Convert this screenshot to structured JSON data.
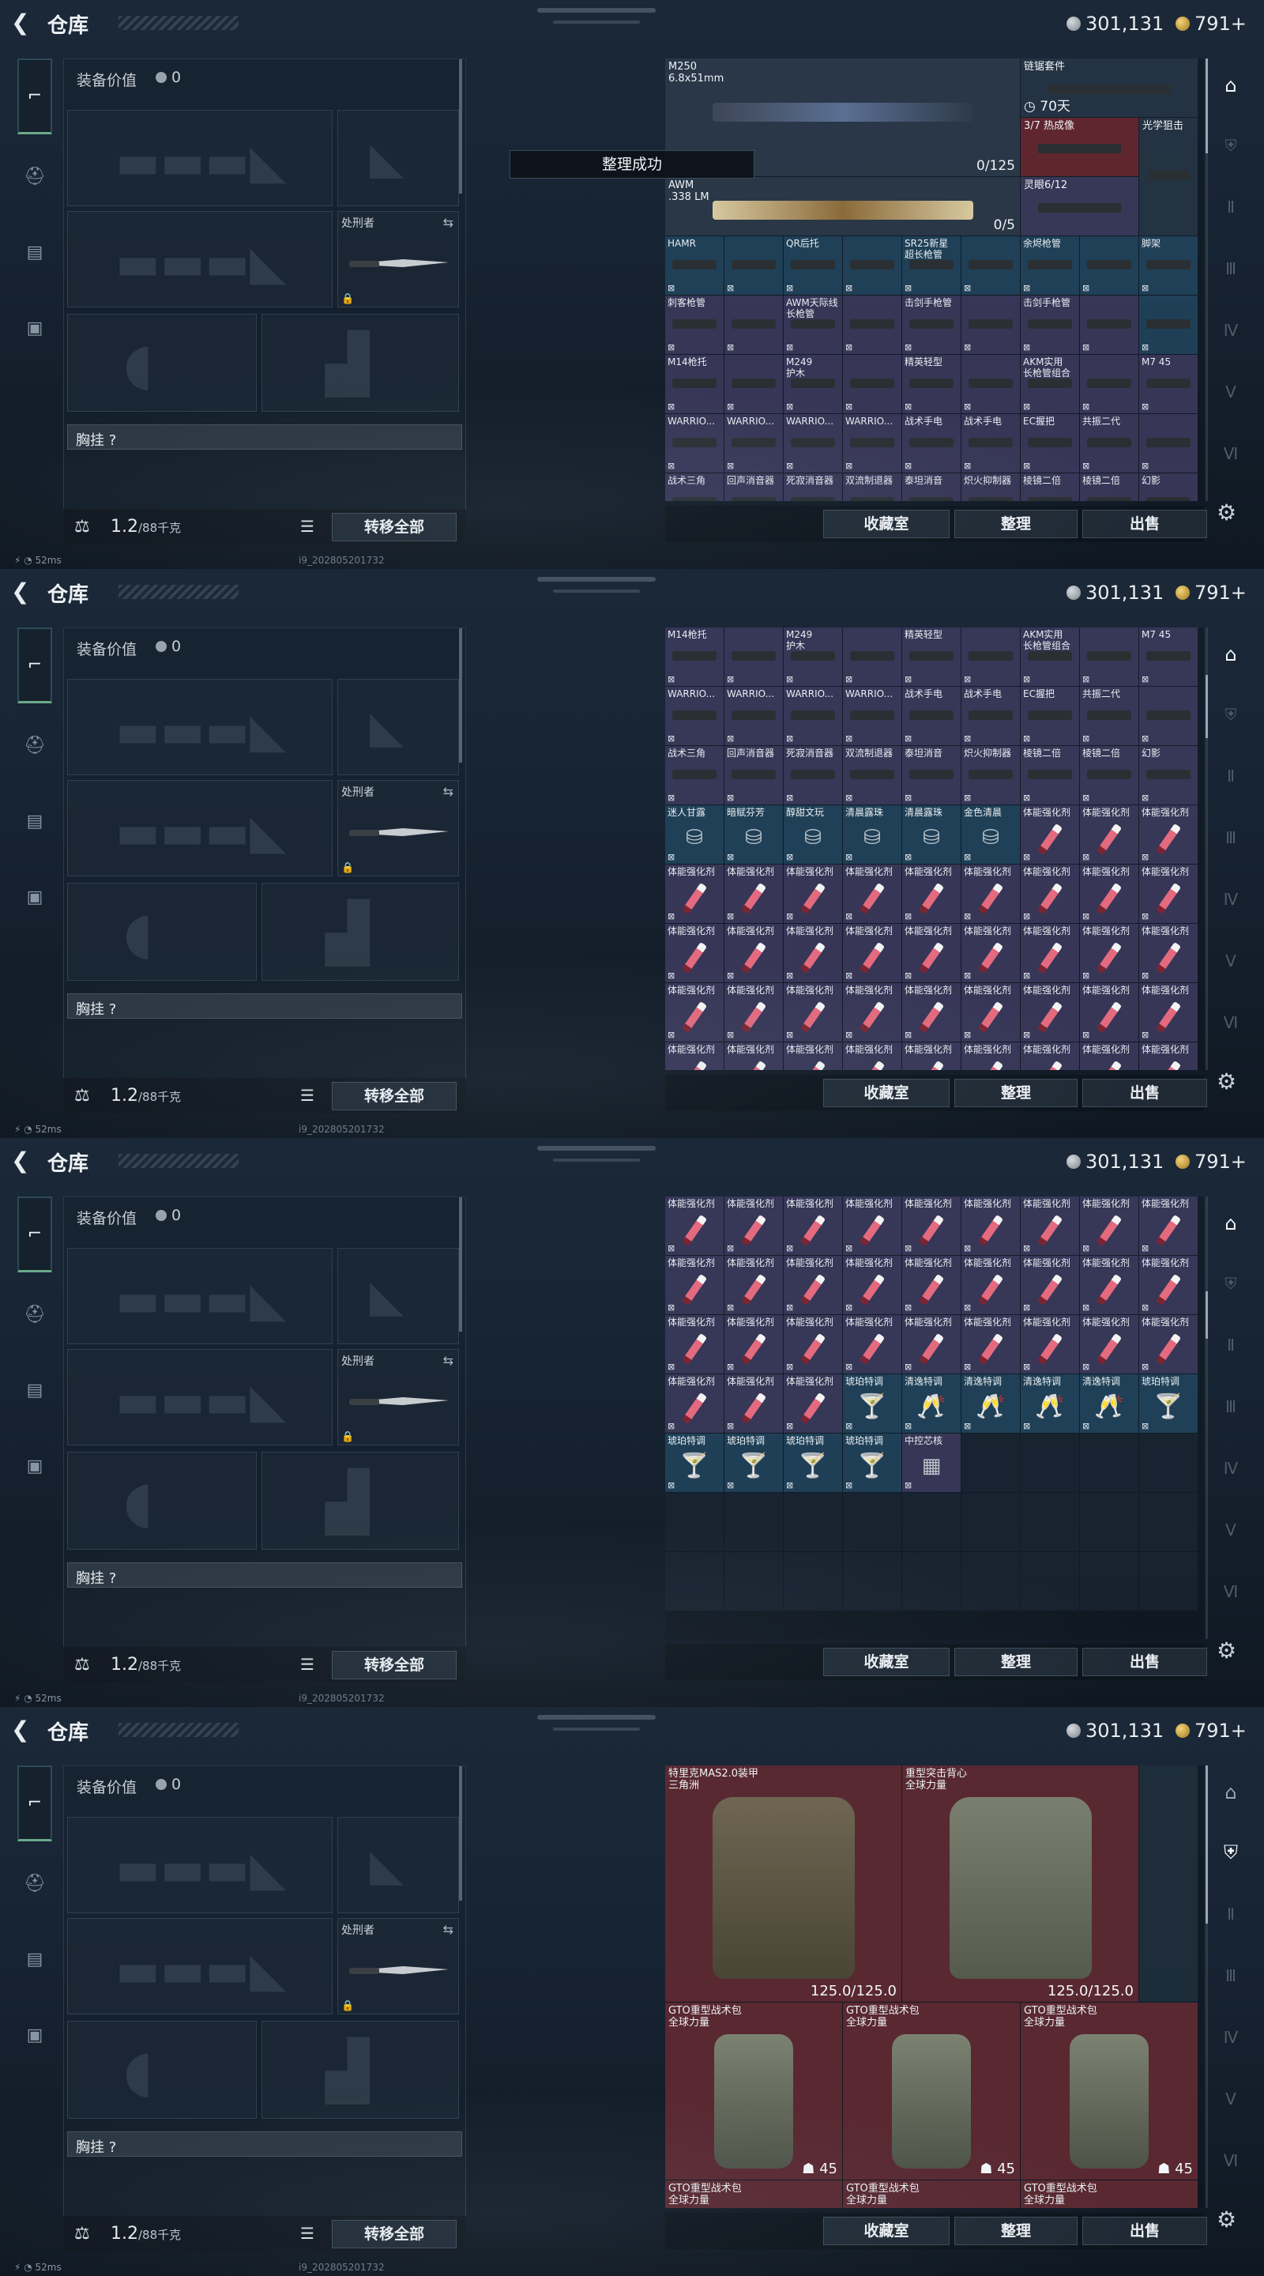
{
  "header": {
    "title": "仓库",
    "back_icon": "back-arrow-icon",
    "currency_silver": "301,131",
    "currency_gold": "791+"
  },
  "left": {
    "equip_value_label": "装备价值",
    "equip_value": "0",
    "knife_label": "处刑者",
    "vest_label": "胸挂 ?",
    "weight": "1.2",
    "weight_unit": "/88千克",
    "move_all": "转移全部"
  },
  "status": {
    "ping": "52ms",
    "build": "i9_20280520173​2"
  },
  "toast": "整理成功",
  "buttons": {
    "store": "收藏室",
    "sort": "整理",
    "sell": "出售"
  },
  "frame0": {
    "big": [
      {
        "name": "M250\n6.8x51mm",
        "count": "0/125"
      },
      {
        "name": "AWM\n.338 LM",
        "count": "0/5"
      }
    ],
    "side": [
      {
        "name": "链锯套件",
        "count": "70天"
      },
      {
        "name": "3/7 热成像"
      },
      {
        "name": "光学狙击"
      },
      {
        "name": "灵眼6/12"
      }
    ],
    "cells": [
      {
        "n": "HAMR",
        "c": "blue"
      },
      {
        "n": "",
        "c": "blue"
      },
      {
        "n": "QR后托",
        "c": "blue"
      },
      {
        "n": "",
        "c": "blue"
      },
      {
        "n": "SR25新星\n超长枪管",
        "c": "blue"
      },
      {
        "n": "",
        "c": "blue"
      },
      {
        "n": "余烬枪管",
        "c": "blue"
      },
      {
        "n": "",
        "c": "blue"
      },
      {
        "n": "脚架",
        "c": "blue"
      },
      {
        "n": "刺客枪管",
        "c": "purple"
      },
      {
        "n": "",
        "c": "purple"
      },
      {
        "n": "AWM天际线\n长枪管",
        "c": "purple"
      },
      {
        "n": "",
        "c": "purple"
      },
      {
        "n": "击剑手枪管",
        "c": "purple"
      },
      {
        "n": "",
        "c": "purple"
      },
      {
        "n": "击剑手枪管",
        "c": "purple"
      },
      {
        "n": "",
        "c": "purple"
      },
      {
        "n": "",
        "c": "blue"
      },
      {
        "n": "M14枪托",
        "c": "purple"
      },
      {
        "n": "",
        "c": "purple"
      },
      {
        "n": "M249\n护木",
        "c": "purple"
      },
      {
        "n": "",
        "c": "purple"
      },
      {
        "n": "精英轻型",
        "c": "purple"
      },
      {
        "n": "",
        "c": "purple"
      },
      {
        "n": "AKM实用\n长枪管组合",
        "c": "purple"
      },
      {
        "n": "",
        "c": "purple"
      },
      {
        "n": "M7 45",
        "c": "purple"
      },
      {
        "n": "WARRIO...",
        "c": "purple"
      },
      {
        "n": "WARRIO...",
        "c": "purple"
      },
      {
        "n": "WARRIO...",
        "c": "purple"
      },
      {
        "n": "WARRIO...",
        "c": "purple"
      },
      {
        "n": "战术手电",
        "c": "purple"
      },
      {
        "n": "战术手电",
        "c": "purple"
      },
      {
        "n": "EC握把",
        "c": "purple"
      },
      {
        "n": "共振二代",
        "c": "purple"
      },
      {
        "n": "",
        "c": "purple"
      },
      {
        "n": "战术三角",
        "c": "purple"
      },
      {
        "n": "回声消音器",
        "c": "purple"
      },
      {
        "n": "死寂消音器",
        "c": "purple"
      },
      {
        "n": "双流制退器",
        "c": "purple"
      },
      {
        "n": "泰坦消音",
        "c": "purple"
      },
      {
        "n": "炽火抑制器",
        "c": "purple"
      },
      {
        "n": "棱镜二倍",
        "c": "purple"
      },
      {
        "n": "棱镜二倍",
        "c": "purple"
      },
      {
        "n": "幻影",
        "c": "purple"
      }
    ]
  },
  "frame1": {
    "cells": [
      {
        "n": "M14枪托",
        "c": "purple"
      },
      {
        "n": "",
        "c": "purple"
      },
      {
        "n": "M249\n护木",
        "c": "purple"
      },
      {
        "n": "",
        "c": "purple"
      },
      {
        "n": "精英轻型",
        "c": "purple"
      },
      {
        "n": "",
        "c": "purple"
      },
      {
        "n": "AKM实用\n长枪管组合",
        "c": "purple"
      },
      {
        "n": "",
        "c": "purple"
      },
      {
        "n": "M7 45",
        "c": "purple"
      },
      {
        "n": "WARRIO...",
        "c": "purple"
      },
      {
        "n": "WARRIO...",
        "c": "purple"
      },
      {
        "n": "WARRIO...",
        "c": "purple"
      },
      {
        "n": "WARRIO...",
        "c": "purple"
      },
      {
        "n": "战术手电",
        "c": "purple"
      },
      {
        "n": "战术手电",
        "c": "purple"
      },
      {
        "n": "EC握把",
        "c": "purple"
      },
      {
        "n": "共振二代",
        "c": "purple"
      },
      {
        "n": "",
        "c": "purple"
      },
      {
        "n": "战术三角",
        "c": "purple"
      },
      {
        "n": "回声消音器",
        "c": "purple"
      },
      {
        "n": "死寂消音器",
        "c": "purple"
      },
      {
        "n": "双流制退器",
        "c": "purple"
      },
      {
        "n": "泰坦消音",
        "c": "purple"
      },
      {
        "n": "炽火抑制器",
        "c": "purple"
      },
      {
        "n": "棱镜二倍",
        "c": "purple"
      },
      {
        "n": "棱镜二倍",
        "c": "purple"
      },
      {
        "n": "幻影",
        "c": "purple"
      },
      {
        "n": "迷人甘露",
        "c": "blue",
        "g": "jar"
      },
      {
        "n": "暗赋芬芳",
        "c": "blue",
        "g": "jar"
      },
      {
        "n": "醇甜文玩",
        "c": "blue",
        "g": "jar"
      },
      {
        "n": "清晨露珠",
        "c": "blue",
        "g": "jar"
      },
      {
        "n": "清晨露珠",
        "c": "blue",
        "g": "jar"
      },
      {
        "n": "金色清晨",
        "c": "blue",
        "g": "jar"
      },
      {
        "n": "体能强化剂",
        "c": "purple",
        "g": "vial"
      },
      {
        "n": "体能强化剂",
        "c": "purple",
        "g": "vial"
      },
      {
        "n": "体能强化剂",
        "c": "purple",
        "g": "vial"
      },
      {
        "n": "体能强化剂",
        "c": "purple",
        "g": "vial"
      },
      {
        "n": "体能强化剂",
        "c": "purple",
        "g": "vial"
      },
      {
        "n": "体能强化剂",
        "c": "purple",
        "g": "vial"
      },
      {
        "n": "体能强化剂",
        "c": "purple",
        "g": "vial"
      },
      {
        "n": "体能强化剂",
        "c": "purple",
        "g": "vial"
      },
      {
        "n": "体能强化剂",
        "c": "purple",
        "g": "vial"
      },
      {
        "n": "体能强化剂",
        "c": "purple",
        "g": "vial"
      },
      {
        "n": "体能强化剂",
        "c": "purple",
        "g": "vial"
      },
      {
        "n": "体能强化剂",
        "c": "purple",
        "g": "vial"
      },
      {
        "n": "体能强化剂",
        "c": "purple",
        "g": "vial"
      },
      {
        "n": "体能强化剂",
        "c": "purple",
        "g": "vial"
      },
      {
        "n": "体能强化剂",
        "c": "purple",
        "g": "vial"
      },
      {
        "n": "体能强化剂",
        "c": "purple",
        "g": "vial"
      },
      {
        "n": "体能强化剂",
        "c": "purple",
        "g": "vial"
      },
      {
        "n": "体能强化剂",
        "c": "purple",
        "g": "vial"
      },
      {
        "n": "体能强化剂",
        "c": "purple",
        "g": "vial"
      },
      {
        "n": "体能强化剂",
        "c": "purple",
        "g": "vial"
      },
      {
        "n": "体能强化剂",
        "c": "purple",
        "g": "vial"
      },
      {
        "n": "体能强化剂",
        "c": "purple",
        "g": "vial"
      },
      {
        "n": "体能强化剂",
        "c": "purple",
        "g": "vial"
      },
      {
        "n": "体能强化剂",
        "c": "purple",
        "g": "vial"
      },
      {
        "n": "体能强化剂",
        "c": "purple",
        "g": "vial"
      },
      {
        "n": "体能强化剂",
        "c": "purple",
        "g": "vial"
      },
      {
        "n": "体能强化剂",
        "c": "purple",
        "g": "vial"
      },
      {
        "n": "体能强化剂",
        "c": "purple",
        "g": "vial"
      },
      {
        "n": "体能强化剂",
        "c": "purple",
        "g": "vial"
      },
      {
        "n": "体能强化剂",
        "c": "purple",
        "g": "vial"
      },
      {
        "n": "体能强化剂",
        "c": "purple",
        "g": "vial"
      },
      {
        "n": "体能强化剂",
        "c": "purple",
        "g": "vial"
      },
      {
        "n": "体能强化剂",
        "c": "purple",
        "g": "vial"
      },
      {
        "n": "体能强化剂",
        "c": "purple",
        "g": "vial"
      },
      {
        "n": "体能强化剂",
        "c": "purple",
        "g": "vial"
      },
      {
        "n": "体能强化剂",
        "c": "purple",
        "g": "vial"
      },
      {
        "n": "体能强化剂",
        "c": "purple",
        "g": "vial"
      },
      {
        "n": "体能强化剂",
        "c": "purple",
        "g": "vial"
      },
      {
        "n": "体能强化剂",
        "c": "purple",
        "g": "vial"
      }
    ]
  },
  "frame2": {
    "cells": [
      {
        "n": "体能强化剂",
        "c": "purple",
        "g": "vial"
      },
      {
        "n": "体能强化剂",
        "c": "purple",
        "g": "vial"
      },
      {
        "n": "体能强化剂",
        "c": "purple",
        "g": "vial"
      },
      {
        "n": "体能强化剂",
        "c": "purple",
        "g": "vial"
      },
      {
        "n": "体能强化剂",
        "c": "purple",
        "g": "vial"
      },
      {
        "n": "体能强化剂",
        "c": "purple",
        "g": "vial"
      },
      {
        "n": "体能强化剂",
        "c": "purple",
        "g": "vial"
      },
      {
        "n": "体能强化剂",
        "c": "purple",
        "g": "vial"
      },
      {
        "n": "体能强化剂",
        "c": "purple",
        "g": "vial"
      },
      {
        "n": "体能强化剂",
        "c": "purple",
        "g": "vial"
      },
      {
        "n": "体能强化剂",
        "c": "purple",
        "g": "vial"
      },
      {
        "n": "体能强化剂",
        "c": "purple",
        "g": "vial"
      },
      {
        "n": "体能强化剂",
        "c": "purple",
        "g": "vial"
      },
      {
        "n": "体能强化剂",
        "c": "purple",
        "g": "vial"
      },
      {
        "n": "体能强化剂",
        "c": "purple",
        "g": "vial"
      },
      {
        "n": "体能强化剂",
        "c": "purple",
        "g": "vial"
      },
      {
        "n": "体能强化剂",
        "c": "purple",
        "g": "vial"
      },
      {
        "n": "体能强化剂",
        "c": "purple",
        "g": "vial"
      },
      {
        "n": "体能强化剂",
        "c": "purple",
        "g": "vial"
      },
      {
        "n": "体能强化剂",
        "c": "purple",
        "g": "vial"
      },
      {
        "n": "体能强化剂",
        "c": "purple",
        "g": "vial"
      },
      {
        "n": "体能强化剂",
        "c": "purple",
        "g": "vial"
      },
      {
        "n": "体能强化剂",
        "c": "purple",
        "g": "vial"
      },
      {
        "n": "体能强化剂",
        "c": "purple",
        "g": "vial"
      },
      {
        "n": "体能强化剂",
        "c": "purple",
        "g": "vial"
      },
      {
        "n": "体能强化剂",
        "c": "purple",
        "g": "vial"
      },
      {
        "n": "体能强化剂",
        "c": "purple",
        "g": "vial"
      },
      {
        "n": "体能强化剂",
        "c": "purple",
        "g": "vial"
      },
      {
        "n": "体能强化剂",
        "c": "purple",
        "g": "vial"
      },
      {
        "n": "体能强化剂",
        "c": "purple",
        "g": "vial"
      },
      {
        "n": "琥珀特调",
        "c": "blue",
        "g": "cocktail"
      },
      {
        "n": "清逸特调",
        "c": "blue",
        "g": "flute"
      },
      {
        "n": "清逸特调",
        "c": "blue",
        "g": "flute"
      },
      {
        "n": "清逸特调",
        "c": "blue",
        "g": "flute"
      },
      {
        "n": "清逸特调",
        "c": "blue",
        "g": "flute"
      },
      {
        "n": "琥珀特调",
        "c": "blue",
        "g": "cocktail"
      },
      {
        "n": "琥珀特调",
        "c": "blue",
        "g": "cocktail"
      },
      {
        "n": "琥珀特调",
        "c": "blue",
        "g": "cocktail"
      },
      {
        "n": "琥珀特调",
        "c": "blue",
        "g": "cocktail"
      },
      {
        "n": "琥珀特调",
        "c": "blue",
        "g": "cocktail"
      },
      {
        "n": "中控芯核",
        "c": "purple",
        "g": "chip"
      },
      {
        "n": "",
        "c": "empty"
      },
      {
        "n": "",
        "c": "empty"
      },
      {
        "n": "",
        "c": "empty"
      },
      {
        "n": "",
        "c": "empty"
      },
      {
        "n": "",
        "c": "empty"
      },
      {
        "n": "",
        "c": "empty"
      },
      {
        "n": "",
        "c": "empty"
      },
      {
        "n": "",
        "c": "empty"
      },
      {
        "n": "",
        "c": "empty"
      },
      {
        "n": "",
        "c": "empty"
      },
      {
        "n": "",
        "c": "empty"
      },
      {
        "n": "",
        "c": "empty"
      },
      {
        "n": "",
        "c": "empty"
      },
      {
        "n": "",
        "c": "empty"
      },
      {
        "n": "",
        "c": "empty"
      },
      {
        "n": "",
        "c": "empty"
      },
      {
        "n": "",
        "c": "empty"
      },
      {
        "n": "",
        "c": "empty"
      },
      {
        "n": "",
        "c": "empty"
      },
      {
        "n": "",
        "c": "empty"
      },
      {
        "n": "",
        "c": "empty"
      },
      {
        "n": "",
        "c": "empty"
      }
    ]
  },
  "frame3": {
    "armor": [
      {
        "name": "特里克MAS2.0装甲\n三角洲",
        "count": "125.0/125.0"
      },
      {
        "name": "重型突击背心\n全球力量",
        "count": "125.0/125.0"
      }
    ],
    "packs": [
      {
        "name": "GTO重型战术包\n全球力量",
        "count": "45"
      },
      {
        "name": "GTO重型战术包\n全球力量",
        "count": "45"
      },
      {
        "name": "GTO重型战术包\n全球力量",
        "count": "45"
      }
    ],
    "packs_next": [
      "GTO重型战术包\n全球力量",
      "GTO重型战术包\n全球力量",
      "GTO重型战术包\n全球力量"
    ]
  }
}
